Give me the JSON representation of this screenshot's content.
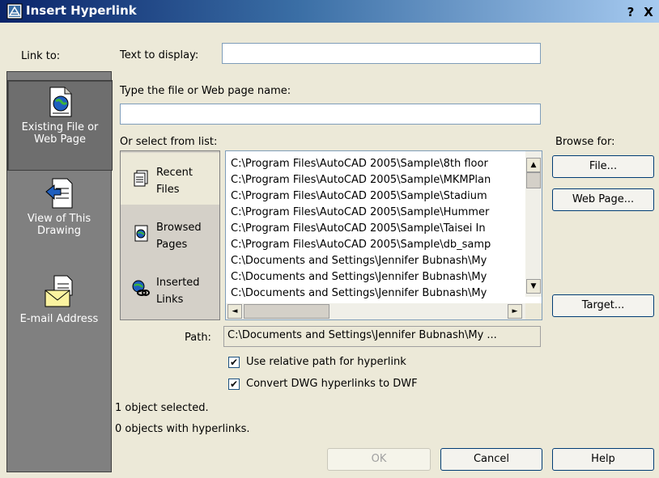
{
  "window": {
    "title": "Insert Hyperlink",
    "help_glyph": "?",
    "close_glyph": "X"
  },
  "link_to": {
    "label": "Link to:",
    "items": [
      {
        "label_line1": "Existing File or",
        "label_line2": "Web Page",
        "icon": "globe-document-icon",
        "selected": true
      },
      {
        "label_line1": "View of This",
        "label_line2": "Drawing",
        "icon": "drawing-view-icon",
        "selected": false
      },
      {
        "label_line1": "E-mail Address",
        "label_line2": "",
        "icon": "envelope-icon",
        "selected": false
      }
    ]
  },
  "text_to_display": {
    "label": "Text to display:",
    "value": ""
  },
  "file_name": {
    "label": "Type the file or Web page name:",
    "value": ""
  },
  "select_list": {
    "label": "Or select from list:",
    "sources": [
      {
        "label": "Recent\nFiles",
        "icon": "recent-files-icon",
        "selected": true
      },
      {
        "label": "Browsed\nPages",
        "icon": "browsed-pages-icon",
        "selected": false
      },
      {
        "label": "Inserted\nLinks",
        "icon": "inserted-links-icon",
        "selected": false
      }
    ],
    "items": [
      "C:\\Program Files\\AutoCAD 2005\\Sample\\8th floor",
      "C:\\Program Files\\AutoCAD 2005\\Sample\\MKMPlan",
      "C:\\Program Files\\AutoCAD 2005\\Sample\\Stadium",
      "C:\\Program Files\\AutoCAD 2005\\Sample\\Hummer",
      "C:\\Program Files\\AutoCAD 2005\\Sample\\Taisei In",
      "C:\\Program Files\\AutoCAD 2005\\Sample\\db_samp",
      "C:\\Documents and Settings\\Jennifer Bubnash\\My",
      "C:\\Documents and Settings\\Jennifer Bubnash\\My",
      "C:\\Documents and Settings\\Jennifer Bubnash\\My"
    ]
  },
  "browse": {
    "label": "Browse for:",
    "file_button": "File...",
    "web_page_button": "Web Page...",
    "target_button": "Target..."
  },
  "path": {
    "label": "Path:",
    "value": "C:\\Documents and Settings\\Jennifer Bubnash\\My ..."
  },
  "options": {
    "relative_path": {
      "label": "Use relative path for hyperlink",
      "checked": true
    },
    "convert_dwg": {
      "label": "Convert DWG hyperlinks to DWF",
      "checked": true
    }
  },
  "status": {
    "selected": "1 object selected.",
    "with_links": "0 objects with hyperlinks."
  },
  "footer": {
    "ok": "OK",
    "cancel": "Cancel",
    "help": "Help"
  },
  "check_glyph": "✔",
  "scroll_glyphs": {
    "up": "▲",
    "down": "▼",
    "left": "◄",
    "right": "►"
  }
}
